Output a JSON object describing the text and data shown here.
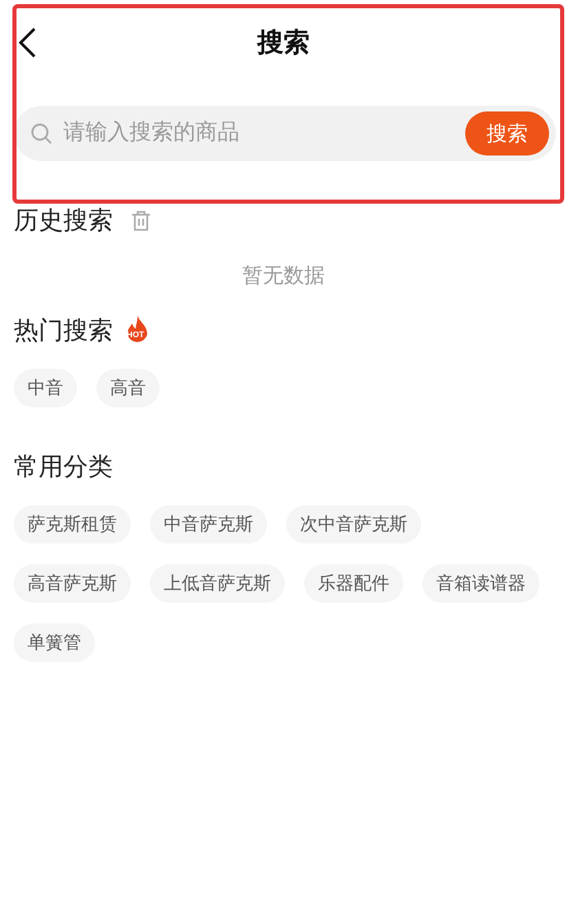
{
  "header": {
    "title": "搜索"
  },
  "search": {
    "placeholder": "请输入搜索的商品",
    "button": "搜索"
  },
  "highlight": true,
  "sections": [
    {
      "kind": "history",
      "title": "历史搜索",
      "empty_text": "暂无数据"
    },
    {
      "kind": "hot",
      "title": "热门搜索",
      "badge": "HOT",
      "tags": [
        "中音",
        "高音"
      ]
    },
    {
      "kind": "categories",
      "title": "常用分类",
      "tags": [
        "萨克斯租赁",
        "中音萨克斯",
        "次中音萨克斯",
        "高音萨克斯",
        "上低音萨克斯",
        "乐器配件",
        "音箱读谱器",
        "单簧管"
      ]
    }
  ]
}
